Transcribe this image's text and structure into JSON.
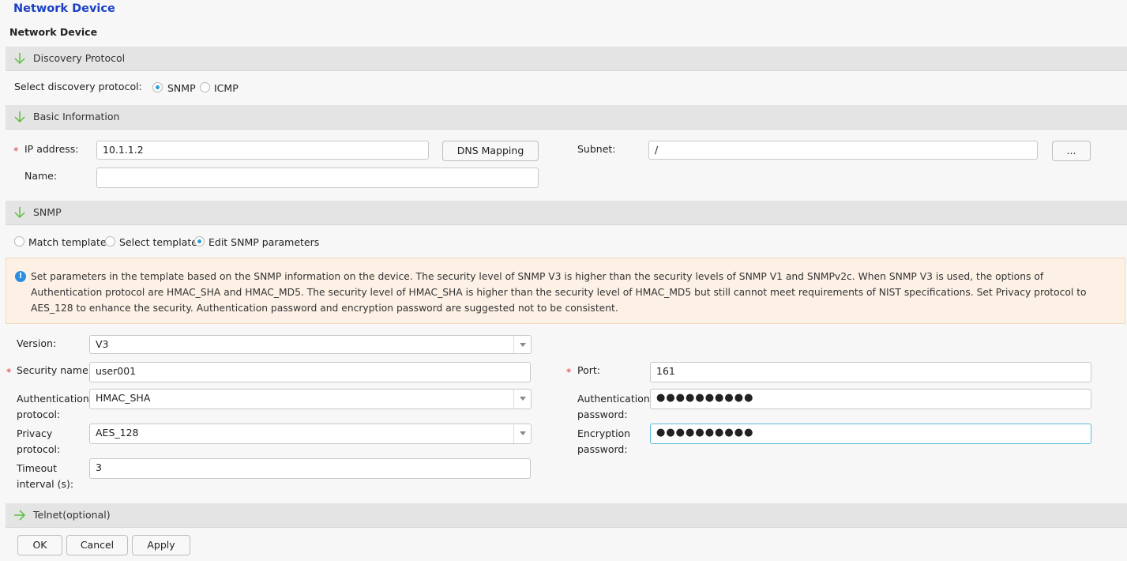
{
  "page": {
    "title": "Network Device",
    "subtitle": "Network Device"
  },
  "discovery": {
    "section_label": "Discovery Protocol",
    "select_label": "Select discovery protocol:",
    "options": [
      "SNMP",
      "ICMP"
    ],
    "selected": "SNMP"
  },
  "basic": {
    "section_label": "Basic Information",
    "ip_label": "IP address:",
    "ip_value": "10.1.1.2",
    "dns_button": "DNS Mapping",
    "subnet_label": "Subnet:",
    "subnet_value": "/",
    "subnet_button": "...",
    "name_label": "Name:",
    "name_value": ""
  },
  "snmp": {
    "section_label": "SNMP",
    "modes": [
      "Match template",
      "Select template",
      "Edit SNMP parameters"
    ],
    "selected_mode": "Edit SNMP parameters",
    "notice": "Set parameters in the template based on the SNMP information on the device. The security level of SNMP V3 is higher than the security levels of SNMP V1 and SNMPv2c. When SNMP V3 is used, the options of Authentication protocol are HMAC_SHA and HMAC_MD5. The security level of HMAC_SHA is higher than the security level of HMAC_MD5 but still cannot meet requirements of NIST specifications. Set Privacy protocol to AES_128 to enhance the security. Authentication password and encryption password are suggested not to be consistent.",
    "version_label": "Version:",
    "version_value": "V3",
    "security_name_label": "Security name:",
    "security_name_value": "user001",
    "port_label": "Port:",
    "port_value": "161",
    "auth_protocol_label_1": "Authentication",
    "auth_protocol_label_2": "protocol:",
    "auth_protocol_value": "HMAC_SHA",
    "auth_password_label_1": "Authentication",
    "auth_password_label_2": "password:",
    "auth_password_value": "●●●●●●●●●●",
    "privacy_protocol_label_1": "Privacy",
    "privacy_protocol_label_2": "protocol:",
    "privacy_protocol_value": "AES_128",
    "encryption_password_label_1": "Encryption",
    "encryption_password_label_2": "password:",
    "encryption_password_value": "●●●●●●●●●●",
    "timeout_label_1": "Timeout",
    "timeout_label_2": "interval (s):",
    "timeout_value": "3"
  },
  "telnet": {
    "section_label": "Telnet(optional)"
  },
  "footer": {
    "ok": "OK",
    "cancel": "Cancel",
    "apply": "Apply"
  },
  "colors": {
    "title": "#1a3fc4",
    "accent": "#2a9fd8",
    "required": "#e03030",
    "section_bg": "#e4e4e4",
    "notice_bg": "#fdf1e6",
    "arrow": "#5cbf3c"
  }
}
